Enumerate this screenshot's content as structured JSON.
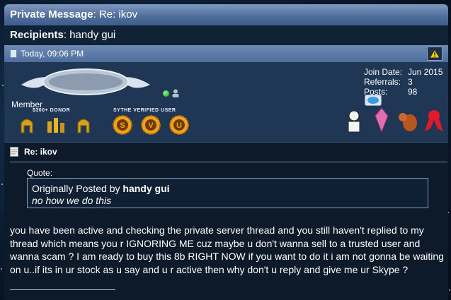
{
  "pm": {
    "title_bold": "Private Message",
    "title_rest": ": Re: ikov",
    "recipients_label": "Recipients",
    "recipients_value": ": handy gui"
  },
  "post": {
    "datetime": "Today, 09:06 PM",
    "user_title": "Member",
    "badges": {
      "donor_label": "$300+ DONOR",
      "verified_label": "SYTHE VERIFIED USER"
    },
    "stats": [
      {
        "label": "Join Date:",
        "value": "Jun 2015"
      },
      {
        "label": "Referrals:",
        "value": "3"
      },
      {
        "label": "Posts:",
        "value": "98"
      }
    ],
    "title": "Re: ikov",
    "quote_label": "Quote:",
    "quote_prefix": "Originally Posted by",
    "quote_author": "handy gui",
    "quote_text": "no how we do this",
    "message": "you have been active and checking the private server thread and you still haven't replied to my thread which means you r IGNORING ME cuz maybe u don't wanna sell to a trusted user and wanna scam ? I am ready to buy this 8b RIGHT NOW if you want to do it i am not gonna be waiting on u..if its in ur stock as u say and u r active then why don't u reply and give me ur Skype ?"
  }
}
